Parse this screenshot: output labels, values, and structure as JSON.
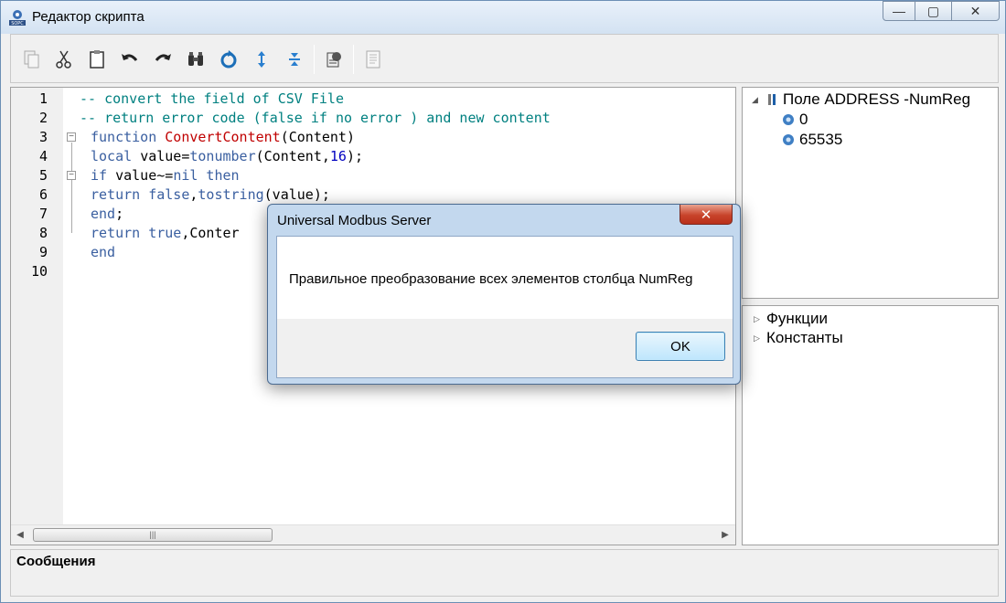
{
  "window": {
    "title": "Редактор скрипта",
    "minimize": "—",
    "maximize": "▢",
    "close": "✕"
  },
  "toolbar": {
    "buttons": [
      {
        "icon": "copy-icon"
      },
      {
        "icon": "cut-icon"
      },
      {
        "icon": "paste-icon"
      },
      {
        "icon": "undo-icon"
      },
      {
        "icon": "redo-icon"
      },
      {
        "icon": "find-icon"
      },
      {
        "icon": "refresh-icon"
      },
      {
        "icon": "expand-icon"
      },
      {
        "icon": "collapse-icon"
      },
      {
        "icon": "run-script-icon"
      },
      {
        "icon": "document-icon"
      }
    ]
  },
  "editor": {
    "line_numbers": [
      "1",
      "2",
      "3",
      "4",
      "5",
      "6",
      "7",
      "8",
      "9",
      "10"
    ],
    "lines": [
      [
        {
          "t": "comment",
          "v": "-- convert the field of CSV File"
        }
      ],
      [
        {
          "t": "comment",
          "v": "-- return error code (false if no error ) and new content"
        }
      ],
      [
        {
          "t": "kw",
          "v": "function "
        },
        {
          "t": "fn",
          "v": "ConvertContent"
        },
        {
          "t": "plain",
          "v": "(Content)"
        }
      ],
      [
        {
          "t": "kw",
          "v": "local "
        },
        {
          "t": "plain",
          "v": "value="
        },
        {
          "t": "builtin",
          "v": "tonumber"
        },
        {
          "t": "plain",
          "v": "(Content,"
        },
        {
          "t": "num",
          "v": "16"
        },
        {
          "t": "plain",
          "v": ");"
        }
      ],
      [
        {
          "t": "kw",
          "v": "if "
        },
        {
          "t": "plain",
          "v": "value~="
        },
        {
          "t": "kw",
          "v": "nil then"
        }
      ],
      [
        {
          "t": "kw",
          "v": "return false"
        },
        {
          "t": "plain",
          "v": ","
        },
        {
          "t": "builtin",
          "v": "tostring"
        },
        {
          "t": "plain",
          "v": "(value);"
        }
      ],
      [
        {
          "t": "kw",
          "v": "end"
        },
        {
          "t": "plain",
          "v": ";"
        }
      ],
      [
        {
          "t": "kw",
          "v": "return true"
        },
        {
          "t": "plain",
          "v": ",Conter"
        }
      ],
      [
        {
          "t": "kw",
          "v": "end"
        }
      ],
      []
    ]
  },
  "tree": {
    "root": "Поле ADDRESS -NumReg",
    "children": [
      "0",
      "65535"
    ]
  },
  "library": {
    "items": [
      "Функции",
      "Константы"
    ]
  },
  "messages": {
    "label": "Сообщения"
  },
  "dialog": {
    "title": "Universal Modbus Server",
    "message": "Правильное преобразование всех элементов столбца NumReg",
    "ok_label": "OK",
    "close": "✕"
  }
}
